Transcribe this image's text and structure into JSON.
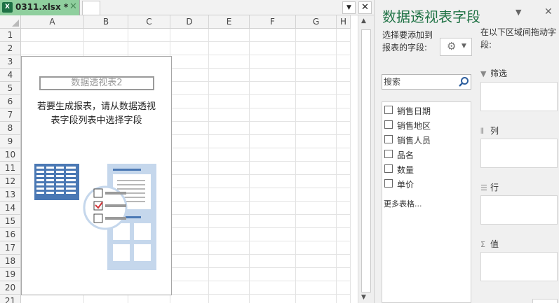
{
  "tab_bar": {
    "file_icon_letter": "X",
    "file_name": "0311.xlsx *",
    "close_glyph": "✕",
    "dropdown_glyph": "▼",
    "close_window_glyph": "✕"
  },
  "spreadsheet": {
    "columns": [
      "A",
      "B",
      "C",
      "D",
      "E",
      "F",
      "G",
      "H"
    ],
    "rows": [
      "1",
      "2",
      "3",
      "4",
      "5",
      "6",
      "7",
      "8",
      "9",
      "10",
      "11",
      "12",
      "13",
      "14",
      "15",
      "16",
      "17",
      "18",
      "19",
      "20",
      "21"
    ],
    "pivot_placeholder": {
      "title": "数据透视表2",
      "hint_line1": "若要生成报表，请从数据透视",
      "hint_line2": "表字段列表中选择字段"
    }
  },
  "scrollbar": {
    "up_glyph": "▲",
    "down_glyph": "▼"
  },
  "pivot_panel": {
    "title": "数据透视表字段",
    "title_dropdown_glyph": "▼",
    "close_glyph": "✕",
    "choose_fields_label": "选择要添加到报表的字段:",
    "tools_caret": "▼",
    "search_placeholder": "搜索",
    "fields": [
      {
        "label": "销售日期",
        "checked": false
      },
      {
        "label": "销售地区",
        "checked": false
      },
      {
        "label": "销售人员",
        "checked": false
      },
      {
        "label": "品名",
        "checked": false
      },
      {
        "label": "数量",
        "checked": false
      },
      {
        "label": "单价",
        "checked": false
      }
    ],
    "more_tables": "更多表格...",
    "drag_areas_label": "在以下区域间拖动字段:",
    "areas": {
      "filter": "筛选",
      "columns": "列",
      "rows": "行",
      "values": "值"
    }
  },
  "colors": {
    "accent_green": "#217346",
    "tab_green": "#8fcf9e",
    "illustration_blue": "#4a78b4",
    "illustration_light_blue": "#c5d7ec"
  }
}
